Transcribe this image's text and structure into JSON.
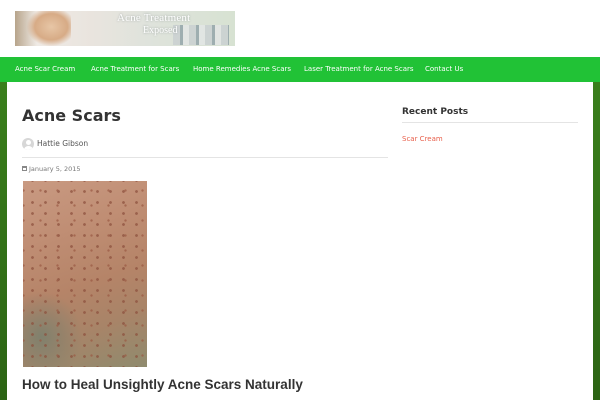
{
  "header": {
    "banner": {
      "line1": "Acne Treatment",
      "line2": "Exposed"
    }
  },
  "nav": {
    "items": [
      {
        "label": "Acne Scar Cream"
      },
      {
        "label": "Acne Treatment for Scars"
      },
      {
        "label": "Home Remedies Acne Scars"
      },
      {
        "label": "Laser Treatment for Acne Scars"
      },
      {
        "label": "Contact Us"
      }
    ]
  },
  "post": {
    "title": "Acne Scars",
    "author": "Hattie Gibson",
    "date": "January 5, 2015",
    "subtitle": "How to Heal Unsightly Acne Scars Naturally"
  },
  "sidebar": {
    "title": "Recent Posts",
    "links": [
      {
        "label": "Scar Cream"
      }
    ]
  },
  "colors": {
    "nav_background": "#21c236",
    "background_side": "#3a7f1c",
    "link": "#e8604c"
  },
  "icons": {
    "author": "avatar-icon",
    "date": "calendar-icon"
  }
}
